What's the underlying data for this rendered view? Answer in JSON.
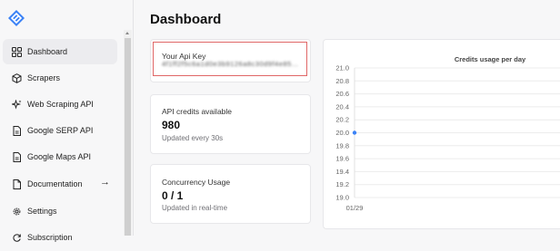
{
  "sidebar": {
    "items": [
      {
        "label": "Dashboard",
        "icon": "grid-icon",
        "active": true
      },
      {
        "label": "Scrapers",
        "icon": "cube-icon"
      },
      {
        "label": "Web Scraping API",
        "icon": "sparkle-icon"
      },
      {
        "label": "Google SERP API",
        "icon": "document-icon"
      },
      {
        "label": "Google Maps API",
        "icon": "document-icon"
      },
      {
        "label": "Documentation",
        "icon": "document-icon",
        "trailing": "→"
      },
      {
        "label": "Settings",
        "icon": "gear-icon"
      },
      {
        "label": "Subscription",
        "icon": "refresh-icon"
      }
    ]
  },
  "main": {
    "title": "Dashboard",
    "api_key_card": {
      "label": "Your Api Key",
      "value": "4f1ff2f5c6a1d0e3b9126a8c30d9f4e85..."
    },
    "credits_card": {
      "label": "API credits available",
      "value": "980",
      "sub": "Updated every 30s"
    },
    "concurrency_card": {
      "label": "Concurrency Usage",
      "value": "0 / 1",
      "sub": "Updated in real-time"
    }
  },
  "colors": {
    "accent": "#3b82f6",
    "highlight_border": "#e06767"
  },
  "chart_data": {
    "type": "line",
    "title": "Credits usage per day",
    "x": [
      "01/29"
    ],
    "series": [
      {
        "values": [
          20.0
        ]
      }
    ],
    "ylim": [
      19.0,
      21.0
    ],
    "yticks": [
      "21.0",
      "20.8",
      "20.6",
      "20.4",
      "20.2",
      "20.0",
      "19.8",
      "19.6",
      "19.4",
      "19.2",
      "19.0"
    ],
    "grid": true
  }
}
